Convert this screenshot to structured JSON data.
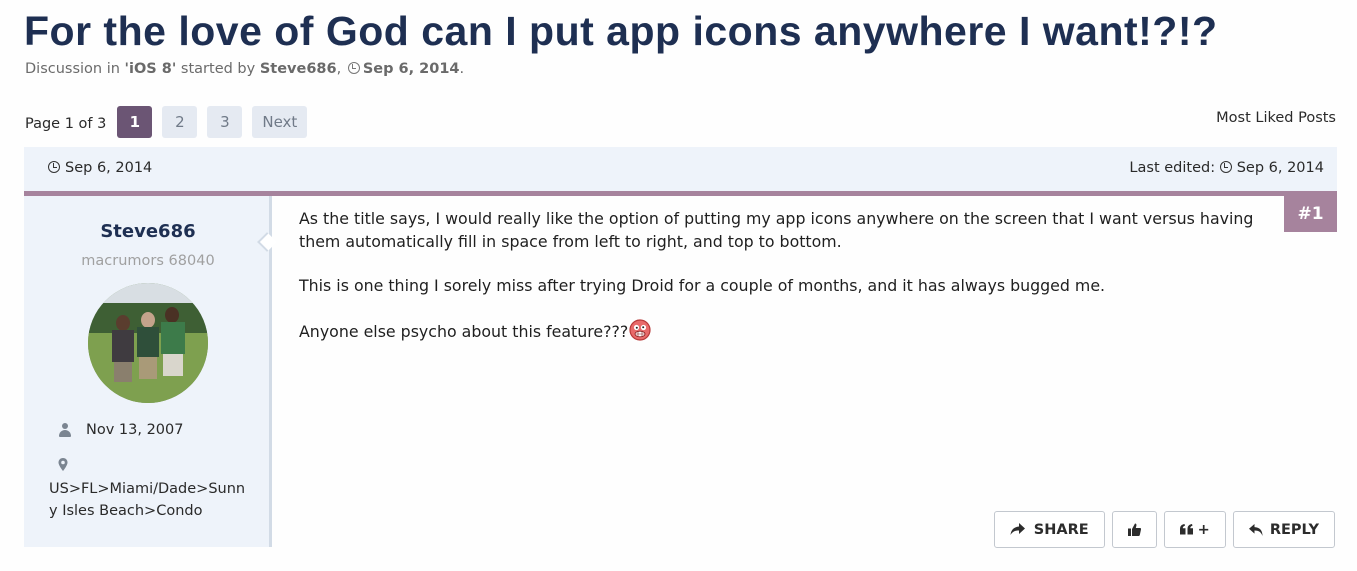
{
  "thread": {
    "title": "For the love of God can I put app icons anywhere I want!?!?",
    "meta_prefix": "Discussion in",
    "forum": "'iOS 8'",
    "started_by": "started by",
    "author": "Steve686",
    "comma": ",",
    "date": "Sep 6, 2014",
    "period": "."
  },
  "pagination": {
    "label": "Page 1 of 3",
    "pages": [
      "1",
      "2",
      "3"
    ],
    "current": "1",
    "next": "Next"
  },
  "most_liked": "Most Liked Posts",
  "post": {
    "date": "Sep 6, 2014",
    "last_edited_label": "Last edited:",
    "last_edited_date": "Sep 6, 2014",
    "number": "#1",
    "paragraphs": [
      "As the title says, I would really like the option of putting my app icons anywhere on the screen that I want versus having them automatically fill in space from left to right, and top to bottom.",
      "This is one thing I sorely miss after trying Droid for a couple of months, and it has always bugged me.",
      "Anyone else psycho about this feature???"
    ]
  },
  "user": {
    "name": "Steve686",
    "title": "macrumors 68040",
    "joined": "Nov 13, 2007",
    "location": "US>FL>Miami/Dade>Sunny Isles Beach>Condo"
  },
  "actions": {
    "share": "SHARE",
    "quote_plus": "+",
    "reply": "REPLY"
  },
  "icons": [
    "clock-icon",
    "user-icon",
    "map-marker-icon",
    "share-icon",
    "thumbs-up-icon",
    "quote-icon",
    "reply-icon",
    "crazy-emoji-icon"
  ],
  "colors": {
    "title": "#1e2f52",
    "accent": "#a6839d",
    "active_page": "#6b5574",
    "panel": "#eef3fa"
  }
}
